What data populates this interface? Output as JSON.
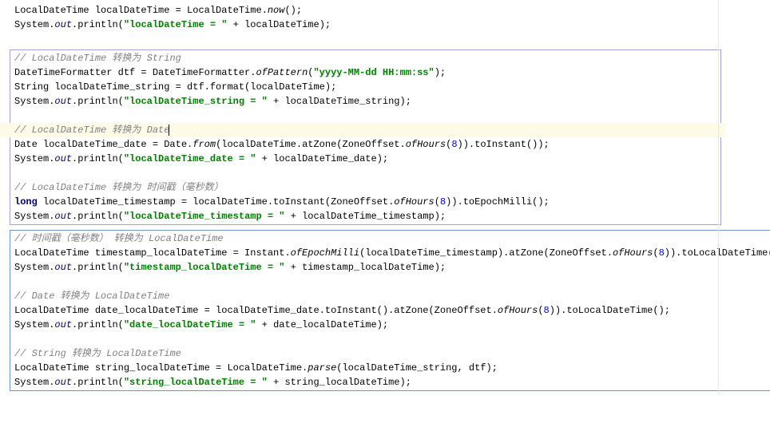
{
  "code": {
    "l1a": "LocalDateTime localDateTime = LocalDateTime.",
    "l1b": "now",
    "l1c": "();",
    "l2a": "System.",
    "l2b": "out",
    "l2c": ".println(",
    "l2d": "\"localDateTime = \"",
    "l2e": " + localDateTime);",
    "c1a": "// LocalDateTime ",
    "c1b": "转换为",
    "c1c": " String",
    "l3a": "DateTimeFormatter dtf = DateTimeFormatter.",
    "l3b": "ofPattern",
    "l3c": "(",
    "l3d": "\"yyyy-MM-dd HH:mm:ss\"",
    "l3e": ");",
    "l4": "String localDateTime_string = dtf.format(localDateTime);",
    "l5a": "System.",
    "l5b": "out",
    "l5c": ".println(",
    "l5d": "\"localDateTime_string = \"",
    "l5e": " + localDateTime_string);",
    "c2a": "// LocalDateTime ",
    "c2b": "转换为",
    "c2c": " Date",
    "l6a": "Date localDateTime_date = Date.",
    "l6b": "from",
    "l6c": "(localDateTime.atZone(ZoneOffset.",
    "l6d": "ofHours",
    "l6e": "(",
    "l6f": "8",
    "l6g": ")).toInstant());",
    "l7a": "System.",
    "l7b": "out",
    "l7c": ".println(",
    "l7d": "\"localDateTime_date = \"",
    "l7e": " + localDateTime_date);",
    "c3a": "// LocalDateTime ",
    "c3b": "转换为 时间戳（毫秒数）",
    "l8a": "long",
    "l8b": " localDateTime_timestamp = localDateTime.toInstant(ZoneOffset.",
    "l8c": "ofHours",
    "l8d": "(",
    "l8e": "8",
    "l8f": ")).toEpochMilli();",
    "l9a": "System.",
    "l9b": "out",
    "l9c": ".println(",
    "l9d": "\"localDateTime_timestamp = \"",
    "l9e": " + localDateTime_timestamp);",
    "c4a": "// ",
    "c4b": "时间戳（毫秒数） 转换为",
    "c4c": " LocalDateTime",
    "l10a": "LocalDateTime timestamp_localDateTime = Instant.",
    "l10b": "ofEpochMilli",
    "l10c": "(localDateTime_timestamp).atZone(ZoneOffset.",
    "l10d": "ofHours",
    "l10e": "(",
    "l10f": "8",
    "l10g": ")).toLocalDateTime();",
    "l11a": "System.",
    "l11b": "out",
    "l11c": ".println(",
    "l11d": "\"timestamp_localDateTime = \"",
    "l11e": " + timestamp_localDateTime);",
    "c5a": "// Date ",
    "c5b": "转换为",
    "c5c": " LocalDateTime",
    "l12a": "LocalDateTime date_localDateTime = localDateTime_date.toInstant().atZone(ZoneOffset.",
    "l12b": "ofHours",
    "l12c": "(",
    "l12d": "8",
    "l12e": ")).toLocalDateTime();",
    "l13a": "System.",
    "l13b": "out",
    "l13c": ".println(",
    "l13d": "\"date_localDateTime = \"",
    "l13e": " + date_localDateTime);",
    "c6a": "// String ",
    "c6b": "转换为",
    "c6c": " LocalDateTime",
    "l14a": "LocalDateTime string_localDateTime = LocalDateTime.",
    "l14b": "parse",
    "l14c": "(localDateTime_string, dtf);",
    "l15a": "System.",
    "l15b": "out",
    "l15c": ".println(",
    "l15d": "\"string_localDateTime = \"",
    "l15e": " + string_localDateTime);"
  }
}
